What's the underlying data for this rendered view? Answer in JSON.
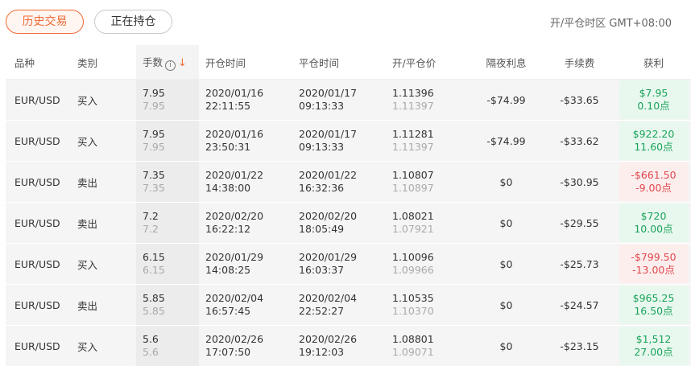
{
  "tabs": {
    "history": "历史交易",
    "open": "正在持仓"
  },
  "timezone": "开/平仓时区 GMT+08:00",
  "columns": {
    "symbol": "品种",
    "type": "类别",
    "lots": "手数",
    "open_time": "开仓时间",
    "close_time": "平仓时间",
    "price": "开/平仓价",
    "swap": "隔夜利息",
    "commission": "手续费",
    "profit": "获利"
  },
  "icons": {
    "info": "info-icon",
    "sort": "sort-desc-arrow-icon"
  },
  "colors": {
    "accent": "#f06a35",
    "gain": "#1aa35a",
    "loss": "#e0474c"
  },
  "rows": [
    {
      "symbol": "EUR/USD",
      "type": "买入",
      "lots": "7.95",
      "lots_sub": "7.95",
      "open_date": "2020/01/16",
      "open_clock": "22:11:55",
      "close_date": "2020/01/17",
      "close_clock": "09:13:33",
      "open_price": "1.11396",
      "close_price": "1.11397",
      "swap": "-$74.99",
      "commission": "-$33.65",
      "profit": "$7.95",
      "points": "0.10点",
      "status": "gain"
    },
    {
      "symbol": "EUR/USD",
      "type": "买入",
      "lots": "7.95",
      "lots_sub": "7.95",
      "open_date": "2020/01/16",
      "open_clock": "23:50:31",
      "close_date": "2020/01/17",
      "close_clock": "09:13:33",
      "open_price": "1.11281",
      "close_price": "1.11397",
      "swap": "-$74.99",
      "commission": "-$33.62",
      "profit": "$922.20",
      "points": "11.60点",
      "status": "gain"
    },
    {
      "symbol": "EUR/USD",
      "type": "卖出",
      "lots": "7.35",
      "lots_sub": "7.35",
      "open_date": "2020/01/22",
      "open_clock": "14:38:00",
      "close_date": "2020/01/22",
      "close_clock": "16:32:36",
      "open_price": "1.10807",
      "close_price": "1.10897",
      "swap": "$0",
      "commission": "-$30.95",
      "profit": "-$661.50",
      "points": "-9.00点",
      "status": "loss"
    },
    {
      "symbol": "EUR/USD",
      "type": "卖出",
      "lots": "7.2",
      "lots_sub": "7.2",
      "open_date": "2020/02/20",
      "open_clock": "16:22:12",
      "close_date": "2020/02/20",
      "close_clock": "18:05:49",
      "open_price": "1.08021",
      "close_price": "1.07921",
      "swap": "$0",
      "commission": "-$29.55",
      "profit": "$720",
      "points": "10.00点",
      "status": "gain"
    },
    {
      "symbol": "EUR/USD",
      "type": "买入",
      "lots": "6.15",
      "lots_sub": "6.15",
      "open_date": "2020/01/29",
      "open_clock": "14:08:25",
      "close_date": "2020/01/29",
      "close_clock": "16:03:37",
      "open_price": "1.10096",
      "close_price": "1.09966",
      "swap": "$0",
      "commission": "-$25.73",
      "profit": "-$799.50",
      "points": "-13.00点",
      "status": "loss"
    },
    {
      "symbol": "EUR/USD",
      "type": "卖出",
      "lots": "5.85",
      "lots_sub": "5.85",
      "open_date": "2020/02/04",
      "open_clock": "16:57:45",
      "close_date": "2020/02/04",
      "close_clock": "22:52:27",
      "open_price": "1.10535",
      "close_price": "1.10370",
      "swap": "$0",
      "commission": "-$24.57",
      "profit": "$965.25",
      "points": "16.50点",
      "status": "gain"
    },
    {
      "symbol": "EUR/USD",
      "type": "买入",
      "lots": "5.6",
      "lots_sub": "5.6",
      "open_date": "2020/02/26",
      "open_clock": "17:07:50",
      "close_date": "2020/02/26",
      "close_clock": "19:12:03",
      "open_price": "1.08801",
      "close_price": "1.09071",
      "swap": "$0",
      "commission": "-$23.15",
      "profit": "$1,512",
      "points": "27.00点",
      "status": "gain"
    }
  ]
}
